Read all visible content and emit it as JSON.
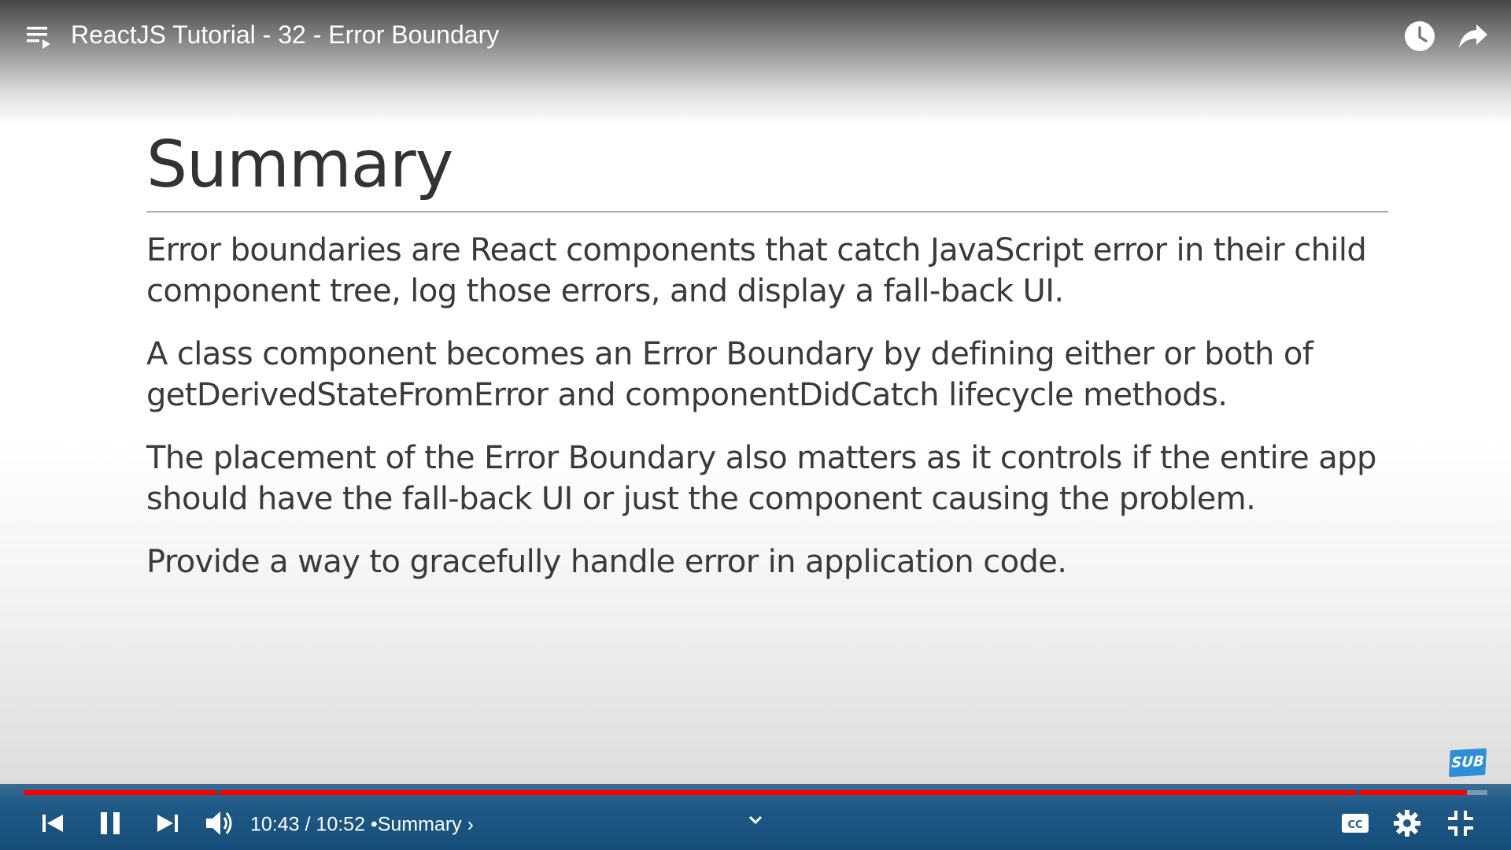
{
  "header": {
    "video_title": "ReactJS Tutorial - 32 - Error Boundary",
    "icons": [
      "playlist-icon",
      "watch-later-icon",
      "share-icon"
    ]
  },
  "slide": {
    "title": "Summary",
    "bullets": [
      [
        "Error boundaries are React components that catch JavaScript error in their child",
        "component tree, log those errors, and display a fall-back UI."
      ],
      [
        "A class component becomes an Error Boundary by defining either or both of",
        "getDerivedStateFromError and componentDidCatch lifecycle methods."
      ],
      [
        "The placement of the Error Boundary also matters as it controls if the entire app",
        "should have the fall-back UI or just the component causing the problem."
      ],
      [
        "Provide a way to gracefully handle error in application code."
      ]
    ]
  },
  "badge": {
    "label": "SUB"
  },
  "player": {
    "current_time": "10:43",
    "separator": "/",
    "duration": "10:52",
    "chapter_separator": "•",
    "chapter": "Summary",
    "chapter_chevron": "›",
    "progress_fraction": 0.986,
    "colors": {
      "progress": "#ff0000",
      "controls_bg": "#1f5a86"
    },
    "icons": [
      "previous-icon",
      "pause-icon",
      "next-icon",
      "volume-icon",
      "chevron-down-icon",
      "captions-icon",
      "settings-icon",
      "exit-fullscreen-icon"
    ]
  }
}
